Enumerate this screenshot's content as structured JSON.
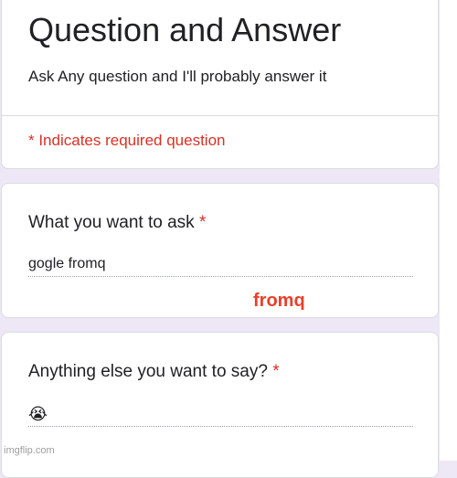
{
  "header": {
    "title": "Question and Answer",
    "description": "Ask Any question and I'll probably answer it",
    "required_note": "* Indicates required question"
  },
  "questions": [
    {
      "title": "What you want to ask",
      "required_marker": "*",
      "answer": "gogle fromq"
    },
    {
      "title": "Anything else you want to say?",
      "required_marker": "*",
      "answer": "😭"
    }
  ],
  "overlay_text": "fromq",
  "watermark": "imgflip.com",
  "colors": {
    "background": "#ede7f6",
    "required": "#d93025",
    "overlay": "#e8402a"
  }
}
